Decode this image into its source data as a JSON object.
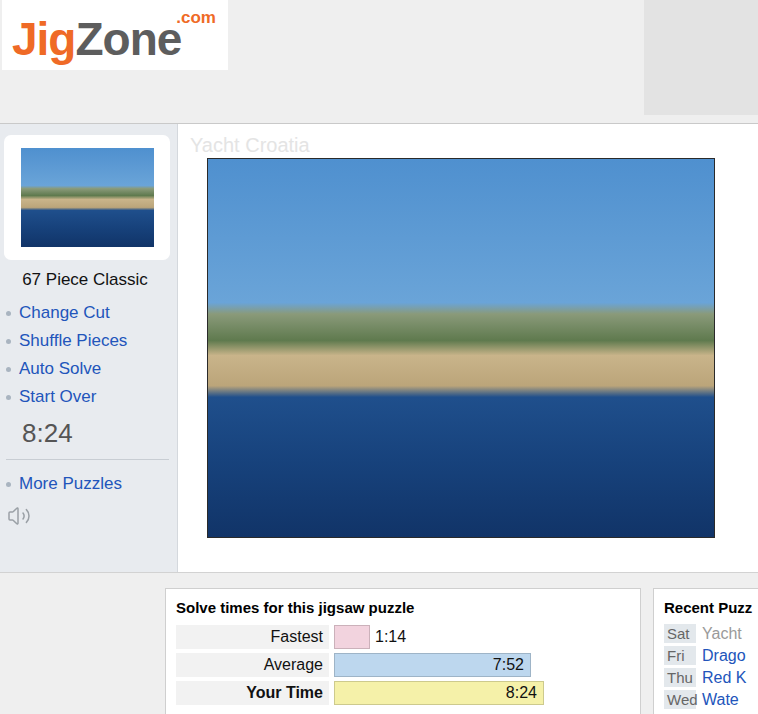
{
  "logo": {
    "brand_a": "Jig",
    "brand_b": "Zone",
    "suffix": ".com"
  },
  "sidebar": {
    "piece_count": "67 Piece Classic",
    "actions": [
      "Change Cut",
      "Shuffle Pieces",
      "Auto Solve",
      "Start Over"
    ],
    "timer": "8:24",
    "links": [
      "More Puzzles"
    ],
    "sound_on": true
  },
  "puzzle": {
    "title": "Yacht Croatia"
  },
  "solve_times": {
    "title": "Solve times for this jigsaw puzzle",
    "rows": [
      {
        "label": "Fastest",
        "time": "1:14",
        "level": 0.17,
        "color": "#f2d3de",
        "selected": false
      },
      {
        "label": "Average",
        "time": "7:52",
        "level": 0.93,
        "color": "#bdd7ee",
        "selected": false
      },
      {
        "label": "Your Time",
        "time": "8:24",
        "level": 0.99,
        "color": "#f5f1a9",
        "selected": true
      }
    ]
  },
  "recent": {
    "title": "Recent Puzz",
    "items": [
      {
        "day": "Sat",
        "name": "Yacht",
        "selected": true
      },
      {
        "day": "Fri",
        "name": "Drago",
        "selected": false
      },
      {
        "day": "Thu",
        "name": "Red K",
        "selected": false
      },
      {
        "day": "Wed",
        "name": "Wate",
        "selected": false
      }
    ]
  }
}
